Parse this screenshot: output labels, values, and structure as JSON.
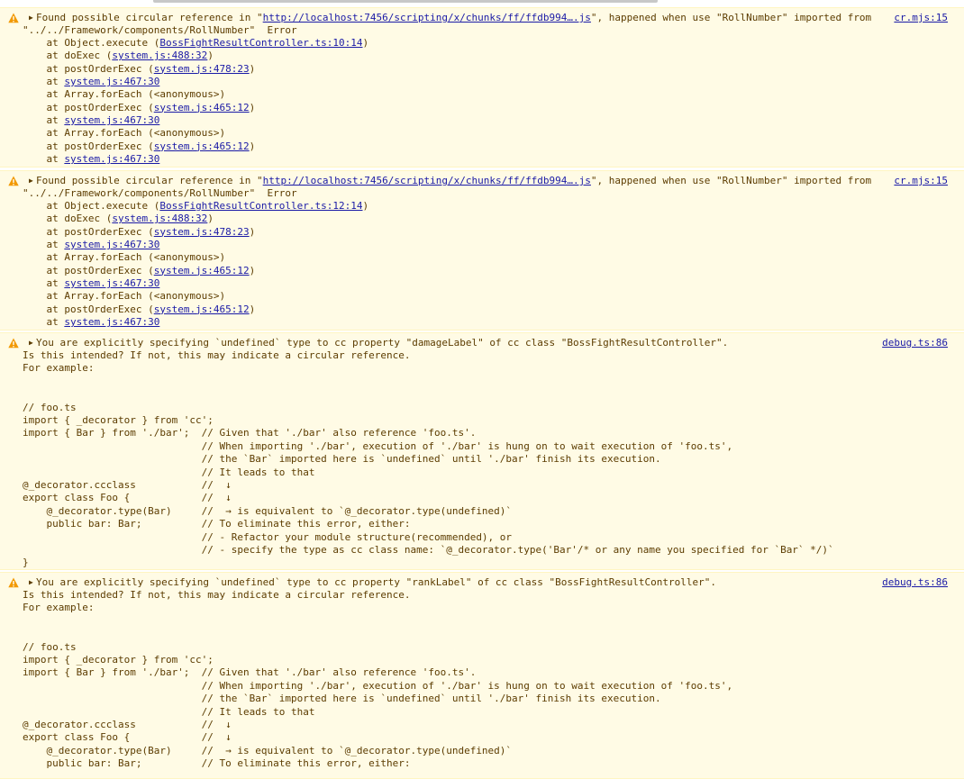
{
  "messages": [
    {
      "source": "cr.mjs:15",
      "head_pre": "Found possible circular reference in \"",
      "head_link": "http://localhost:7456/scripting/x/chunks/ff/ffdb994….js",
      "head_post": "\", happened when use \"RollNumber\" imported from",
      "line2": "\"../../Framework/components/RollNumber\"  Error",
      "frames": [
        {
          "pre": "    at Object.execute (",
          "link": "BossFightResultController.ts:10:14",
          "post": ")"
        },
        {
          "pre": "    at doExec (",
          "link": "system.js:488:32",
          "post": ")"
        },
        {
          "pre": "    at postOrderExec (",
          "link": "system.js:478:23",
          "post": ")"
        },
        {
          "pre": "    at ",
          "link": "system.js:467:30",
          "post": ""
        },
        {
          "pre": "    at Array.forEach (<anonymous>)",
          "link": "",
          "post": ""
        },
        {
          "pre": "    at postOrderExec (",
          "link": "system.js:465:12",
          "post": ")"
        },
        {
          "pre": "    at ",
          "link": "system.js:467:30",
          "post": ""
        },
        {
          "pre": "    at Array.forEach (<anonymous>)",
          "link": "",
          "post": ""
        },
        {
          "pre": "    at postOrderExec (",
          "link": "system.js:465:12",
          "post": ")"
        },
        {
          "pre": "    at ",
          "link": "system.js:467:30",
          "post": ""
        }
      ]
    },
    {
      "source": "cr.mjs:15",
      "head_pre": "Found possible circular reference in \"",
      "head_link": "http://localhost:7456/scripting/x/chunks/ff/ffdb994….js",
      "head_post": "\", happened when use \"RollNumber\" imported from",
      "line2": "\"../../Framework/components/RollNumber\"  Error",
      "frames": [
        {
          "pre": "    at Object.execute (",
          "link": "BossFightResultController.ts:12:14",
          "post": ")"
        },
        {
          "pre": "    at doExec (",
          "link": "system.js:488:32",
          "post": ")"
        },
        {
          "pre": "    at postOrderExec (",
          "link": "system.js:478:23",
          "post": ")"
        },
        {
          "pre": "    at ",
          "link": "system.js:467:30",
          "post": ""
        },
        {
          "pre": "    at Array.forEach (<anonymous>)",
          "link": "",
          "post": ""
        },
        {
          "pre": "    at postOrderExec (",
          "link": "system.js:465:12",
          "post": ")"
        },
        {
          "pre": "    at ",
          "link": "system.js:467:30",
          "post": ""
        },
        {
          "pre": "    at Array.forEach (<anonymous>)",
          "link": "",
          "post": ""
        },
        {
          "pre": "    at postOrderExec (",
          "link": "system.js:465:12",
          "post": ")"
        },
        {
          "pre": "    at ",
          "link": "system.js:467:30",
          "post": ""
        }
      ]
    },
    {
      "source": "debug.ts:86",
      "head": "You are explicitly specifying `undefined` type to cc property \"damageLabel\" of cc class \"BossFightResultController\".",
      "lines": [
        "Is this intended? If not, this may indicate a circular reference.",
        "For example:",
        "",
        "",
        "// foo.ts",
        "import { _decorator } from 'cc';",
        "import { Bar } from './bar';  // Given that './bar' also reference 'foo.ts'.",
        "                              // When importing './bar', execution of './bar' is hung on to wait execution of 'foo.ts',",
        "                              // the `Bar` imported here is `undefined` until './bar' finish its execution.",
        "                              // It leads to that",
        "@_decorator.ccclass           //  ↓",
        "export class Foo {            //  ↓",
        "    @_decorator.type(Bar)     //  → is equivalent to `@_decorator.type(undefined)`",
        "    public bar: Bar;          // To eliminate this error, either:",
        "                              // - Refactor your module structure(recommended), or",
        "                              // - specify the type as cc class name: `@_decorator.type('Bar'/* or any name you specified for `Bar` */)`",
        "}"
      ]
    },
    {
      "source": "debug.ts:86",
      "head": "You are explicitly specifying `undefined` type to cc property \"rankLabel\" of cc class \"BossFightResultController\".",
      "lines": [
        "Is this intended? If not, this may indicate a circular reference.",
        "For example:",
        "",
        "",
        "// foo.ts",
        "import { _decorator } from 'cc';",
        "import { Bar } from './bar';  // Given that './bar' also reference 'foo.ts'.",
        "                              // When importing './bar', execution of './bar' is hung on to wait execution of 'foo.ts',",
        "                              // the `Bar` imported here is `undefined` until './bar' finish its execution.",
        "                              // It leads to that",
        "@_decorator.ccclass           //  ↓",
        "export class Foo {            //  ↓",
        "    @_decorator.type(Bar)     //  → is equivalent to `@_decorator.type(undefined)`",
        "    public bar: Bar;          // To eliminate this error, either:"
      ]
    }
  ],
  "colors": {
    "warning_bg": "#fffbe5",
    "warning_border": "#fff5c2",
    "warning_text": "#5c3c00",
    "link": "#1a1aa6",
    "warning_icon": "#f29900"
  }
}
